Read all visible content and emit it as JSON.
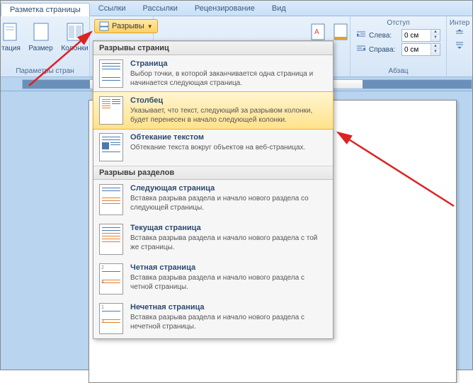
{
  "tabs": {
    "page_layout": "Разметка страницы",
    "links": "Ссылки",
    "mailings": "Рассылки",
    "review": "Рецензирование",
    "view": "Вид"
  },
  "ribbon": {
    "orientation": "тация",
    "size": "Размер",
    "columns": "Колонки",
    "page_params": "Параметры стран",
    "breaks": "Разрывы",
    "paragraph_label": "Абзац"
  },
  "indent": {
    "group_title": "Отступ",
    "left_label": "Слева:",
    "right_label": "Справа:",
    "left_value": "0 см",
    "right_value": "0 см"
  },
  "inter": {
    "group_title": "Интер"
  },
  "dropdown": {
    "section_page": "Разрывы страниц",
    "section_sections": "Разрывы разделов",
    "items": [
      {
        "title": "Страница",
        "desc": "Выбор точки, в которой заканчивается одна страница и начинается следующая страница."
      },
      {
        "title": "Столбец",
        "desc": "Указывает, что текст, следующий за разрывом колонки, будет перенесен в начало следующей колонки."
      },
      {
        "title": "Обтекание текстом",
        "desc": "Обтекание текста вокруг объектов на веб-страницах."
      }
    ],
    "section_items": [
      {
        "title": "Следующая страница",
        "desc": "Вставка разрыва раздела и начало нового раздела со следующей страницы."
      },
      {
        "title": "Текущая страница",
        "desc": "Вставка разрыва раздела и начало нового раздела с той же страницы."
      },
      {
        "title": "Четная страница",
        "desc": "Вставка разрыва раздела и начало нового раздела с четной страницы."
      },
      {
        "title": "Нечетная страница",
        "desc": "Вставка разрыва раздела и начало нового раздела с нечетной страницы."
      }
    ]
  }
}
